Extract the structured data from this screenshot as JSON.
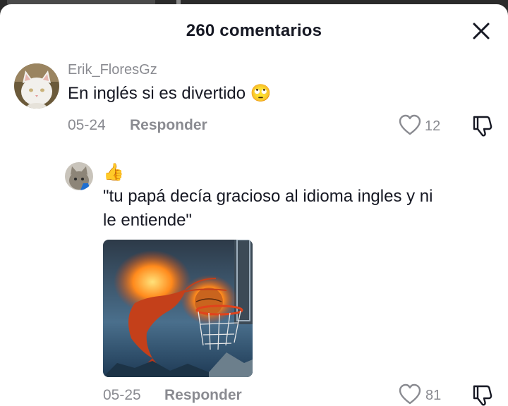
{
  "header": {
    "title": "260 comentarios"
  },
  "comments": [
    {
      "username": "Erik_FloresGz",
      "text": "En inglés si es divertido 🙄",
      "date": "05-24",
      "reply_label": "Responder",
      "likes": "12"
    }
  ],
  "reply": {
    "emoji": "👍",
    "text_line1": "\"tu papá decía gracioso al idioma ingles y ni",
    "text_line2": "le entiende\"",
    "date": "05-25",
    "reply_label": "Responder",
    "likes": "81"
  },
  "icons": [
    "close-icon",
    "heart-icon",
    "dislike-icon"
  ],
  "colors": {
    "text": "#161823",
    "secondary": "#8a8b91",
    "background": "#ffffff"
  }
}
